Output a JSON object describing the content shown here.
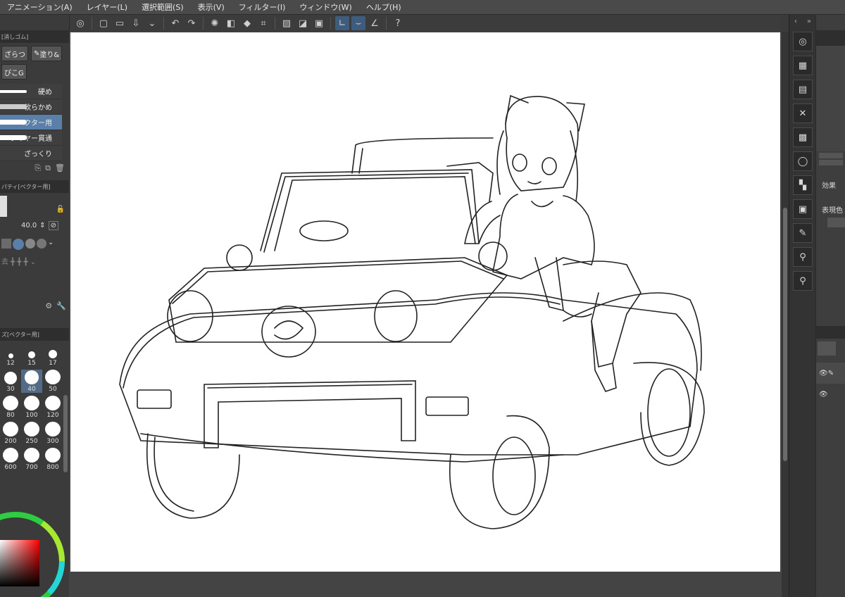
{
  "menu": {
    "items": [
      "アニメーション(A)",
      "レイヤー(L)",
      "選択範囲(S)",
      "表示(V)",
      "フィルター(I)",
      "ウィンドウ(W)",
      "ヘルプ(H)"
    ]
  },
  "tool_panel": {
    "header": "[消しゴム]",
    "subtools": [
      "ざらつ",
      "塗り&",
      "ぴこG"
    ],
    "brushes": [
      {
        "label": "硬め"
      },
      {
        "label": "軟らかめ"
      },
      {
        "label": "ベクター用",
        "selected": true
      },
      {
        "label": "レイヤー貫通"
      },
      {
        "label": "ざっくり"
      }
    ]
  },
  "property_panel": {
    "header": "パティ[ベクター用]",
    "size_value": "40.0"
  },
  "brush_size_panel": {
    "header": "ズ[ベクター用]",
    "sizes": [
      "12",
      "15",
      "17",
      "30",
      "40",
      "50",
      "80",
      "100",
      "120",
      "200",
      "250",
      "300",
      "600",
      "700",
      "800"
    ],
    "selected": "40"
  },
  "right_panel": {
    "effect_label": "効果",
    "expression_color_label": "表現色"
  },
  "colors": {
    "accent": "#5a7fa8",
    "canvas": "#ffffff",
    "ui_dark": "#3a3a3a"
  }
}
